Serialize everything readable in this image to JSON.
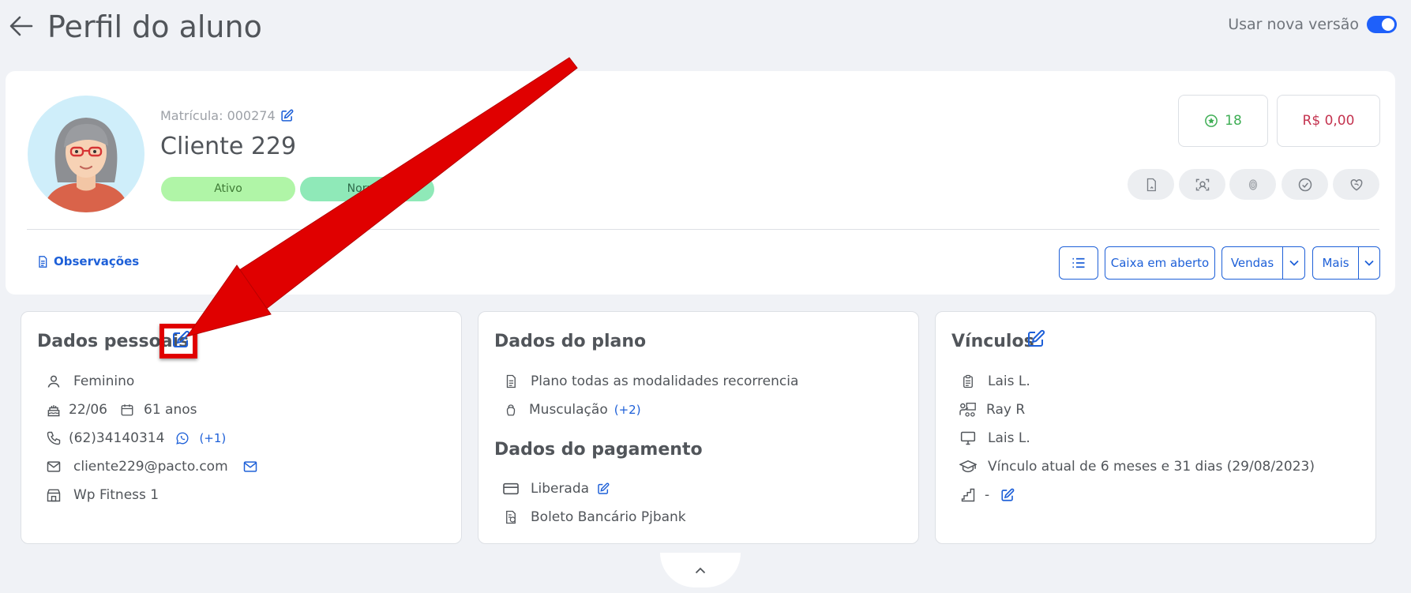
{
  "header": {
    "title": "Perfil do aluno",
    "new_version_label": "Usar nova versão"
  },
  "client": {
    "matricula_label": "Matrícula: 000274",
    "name": "Cliente 229",
    "badges": [
      "Ativo",
      "Normal"
    ],
    "points": "18",
    "balance": "R$ 0,00"
  },
  "toolbar": {
    "observacoes": "Observações",
    "caixa": "Caixa em aberto",
    "vendas": "Vendas",
    "mais": "Mais"
  },
  "dados_pessoais": {
    "title": "Dados pessoais",
    "gender": "Feminino",
    "birthday": "22/06",
    "age": "61 anos",
    "phone": "(62)34140314",
    "phone_extra": "(+1)",
    "email": "cliente229@pacto.com",
    "unit": "Wp Fitness 1"
  },
  "dados_plano": {
    "title": "Dados do plano",
    "plan": "Plano todas as modalidades recorrencia",
    "modality": "Musculação",
    "modality_extra": "(+2)"
  },
  "dados_pagamento": {
    "title": "Dados do pagamento",
    "status": "Liberada",
    "method": "Boleto Bancário Pjbank"
  },
  "vinculos": {
    "title": "Vínculos",
    "consultor": "Lais L.",
    "professor": "Ray R",
    "professor_tw": "Lais L.",
    "vinculo_atual": "Vínculo atual de 6 meses e 31 dias (29/08/2023)",
    "nivel": "-"
  },
  "colors": {
    "primary": "#1e60d8",
    "badge_ativo": "#b0f5a7",
    "badge_normal": "#8fe9b8",
    "points": "#3fae55",
    "balance": "#c4334f",
    "annotation": "#e00000"
  }
}
